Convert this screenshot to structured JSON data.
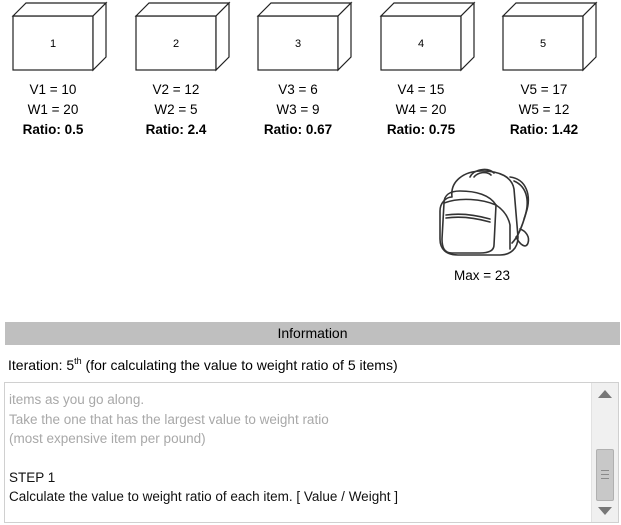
{
  "items": [
    {
      "label": "1",
      "value_text": "V1 = 10",
      "weight_text": "W1 = 20",
      "ratio_text": "Ratio: 0.5"
    },
    {
      "label": "2",
      "value_text": "V2 = 12",
      "weight_text": "W2 = 5",
      "ratio_text": "Ratio: 2.4"
    },
    {
      "label": "3",
      "value_text": "V3 = 6",
      "weight_text": "W3 = 9",
      "ratio_text": "Ratio: 0.67"
    },
    {
      "label": "4",
      "value_text": "V4 = 15",
      "weight_text": "W4 = 20",
      "ratio_text": "Ratio: 0.75"
    },
    {
      "label": "5",
      "value_text": "V5 = 17",
      "weight_text": "W5 = 12",
      "ratio_text": "Ratio: 1.42"
    }
  ],
  "knapsack": {
    "max_label": "Max = 23",
    "icon": "backpack-icon"
  },
  "info_panel": {
    "title": "Information",
    "iteration_prefix": "Iteration: 5",
    "iteration_sup": "th",
    "iteration_suffix": " (for calculating the value to weight ratio of 5 items)",
    "text_lines_faded": [
      "items as you go along.",
      "Take the one that has the largest value to weight ratio",
      "(most expensive item per pound)"
    ],
    "step_title": "STEP 1",
    "step_text": "Calculate the value to weight ratio of each item. [ Value / Weight ]"
  },
  "scrollbar": {
    "up_icon": "scroll-up-arrow-icon",
    "down_icon": "scroll-down-arrow-icon"
  }
}
